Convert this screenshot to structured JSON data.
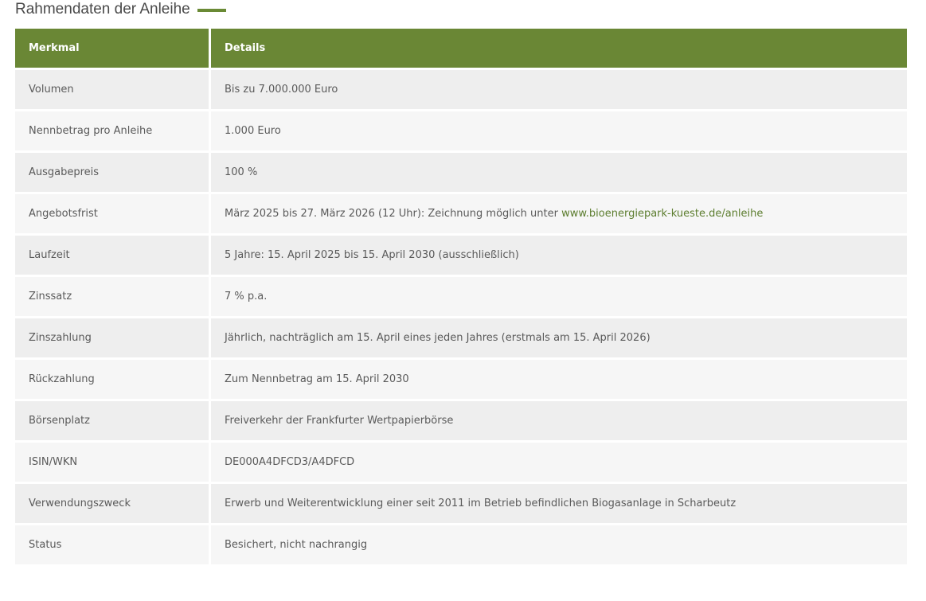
{
  "section": {
    "title": "Rahmendaten der Anleihe",
    "accent_color": "#6a8735"
  },
  "table": {
    "headers": {
      "key": "Merkmal",
      "value": "Details"
    },
    "rows": [
      {
        "key": "Volumen",
        "value": "Bis zu 7.000.000 Euro"
      },
      {
        "key": "Nennbetrag pro Anleihe",
        "value": "1.000 Euro"
      },
      {
        "key": "Ausgabepreis",
        "value": "100 %"
      },
      {
        "key": "Angebotsfrist",
        "value": "März 2025 bis 27. März 2026 (12 Uhr): Zeichnung möglich unter ",
        "link": "www.bioenergiepark-kueste.de/anleihe"
      },
      {
        "key": "Laufzeit",
        "value": "5 Jahre: 15. April 2025 bis 15. April 2030 (ausschließlich)"
      },
      {
        "key": "Zinssatz",
        "value": "7 % p.a."
      },
      {
        "key": "Zinszahlung",
        "value": "Jährlich, nachträglich am 15. April eines jeden Jahres (erstmals am 15. April 2026)"
      },
      {
        "key": "Rückzahlung",
        "value": "Zum Nennbetrag am 15. April 2030"
      },
      {
        "key": "Börsenplatz",
        "value": "Freiverkehr der Frankfurter Wertpapierbörse"
      },
      {
        "key": "ISIN/WKN",
        "value": "DE000A4DFCD3/A4DFCD"
      },
      {
        "key": "Verwendungszweck",
        "value": "Erwerb und Weiterentwicklung einer seit 2011 im Betrieb befindlichen Biogasanlage in Scharbeutz"
      },
      {
        "key": "Status",
        "value": "Besichert, nicht nachrangig"
      }
    ]
  }
}
